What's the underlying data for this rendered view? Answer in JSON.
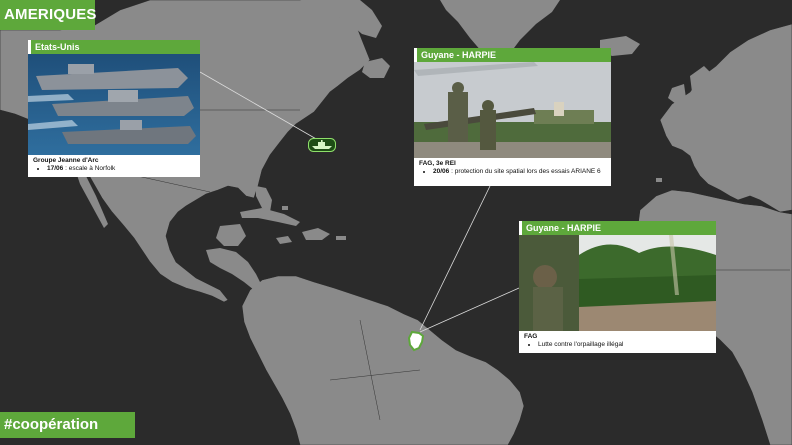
{
  "header": {
    "title": "AMERIQUES"
  },
  "footer": {
    "hashtag": "#coopération"
  },
  "colors": {
    "accent": "#5ea83b",
    "land": "#8a8a8a",
    "sea": "#2b2b2b"
  },
  "cards": [
    {
      "region": "Etats-Unis",
      "heading": "Groupe Jeanne d'Arc",
      "items": [
        {
          "date": "17/06",
          "text": " : escale à Norfolk"
        }
      ]
    },
    {
      "region": "Guyane - HARPIE",
      "heading": "FAG, 3e REI",
      "items": [
        {
          "date": "20/06",
          "text": " : protection du site spatial lors des essais ARIANE 6"
        }
      ]
    },
    {
      "region": "Guyane - HARPIE",
      "heading": "FAG",
      "items": [
        {
          "date": "",
          "text": "Lutte contre l'orpaillage illégal"
        }
      ]
    }
  ],
  "icons": {
    "us_marker": "ship-icon",
    "guyane_marker": "guyane-territory-icon"
  }
}
